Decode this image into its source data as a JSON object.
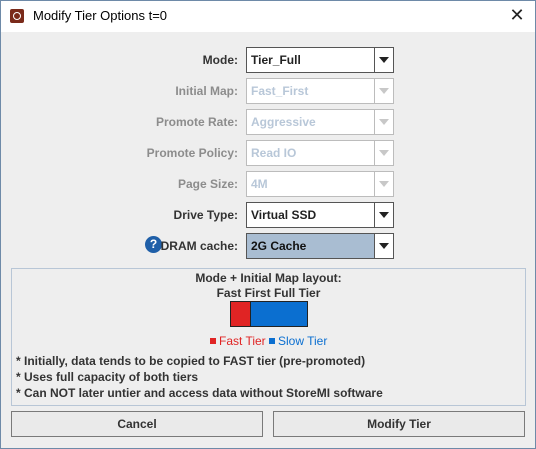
{
  "window": {
    "title": "Modify Tier Options t=0",
    "close_glyph": "✕"
  },
  "form": {
    "mode": {
      "label": "Mode:",
      "value": "Tier_Full",
      "enabled": true
    },
    "initial_map": {
      "label": "Initial Map:",
      "value": "Fast_First",
      "enabled": false
    },
    "promote_rate": {
      "label": "Promote Rate:",
      "value": "Aggressive",
      "enabled": false
    },
    "promote_policy": {
      "label": "Promote Policy:",
      "value": "Read IO",
      "enabled": false
    },
    "page_size": {
      "label": "Page Size:",
      "value": "4M",
      "enabled": false
    },
    "drive_type": {
      "label": "Drive Type:",
      "value": "Virtual SSD",
      "enabled": true
    },
    "dram_cache": {
      "label": "DRAM cache:",
      "value": "2G Cache",
      "enabled": true,
      "help_glyph": "?"
    }
  },
  "layout_panel": {
    "heading": "Mode + Initial Map layout:",
    "subheading": "Fast First Full Tier",
    "fast_fraction": 0.25,
    "legend": [
      {
        "label": "Fast Tier",
        "color": "#e02424"
      },
      {
        "label": "Slow Tier",
        "color": "#0b6fd0"
      }
    ],
    "notes": [
      "* Initially, data tends to be copied to FAST tier (pre-promoted)",
      "* Uses full capacity of both tiers",
      "* Can NOT later untier and access data without StoreMI software"
    ]
  },
  "buttons": {
    "cancel": "Cancel",
    "modify": "Modify Tier"
  }
}
